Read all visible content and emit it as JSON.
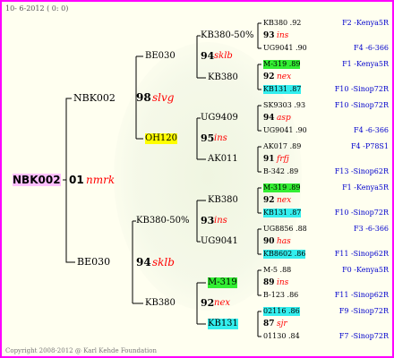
{
  "header": {
    "date_text": "10- 6-2012 ( 0: 0)"
  },
  "footer": {
    "copyright": "Copyright 2008-2012 @ Karl Kehde Foundation"
  },
  "colors": {
    "border": "#ff00ff",
    "red": "#ff0000",
    "blue": "#0000cc",
    "green_hl": "#33ee33",
    "cyan_hl": "#33eeee",
    "yellow_hl": "#ffff00",
    "pink_hl": "#ffc0ff"
  },
  "root": {
    "name": "NBK002",
    "num": "01",
    "tag": "nmrk"
  },
  "gen2": {
    "sire": {
      "name": "NBK002",
      "num": "98",
      "tag": "slvg"
    },
    "dam": {
      "name": "BE030",
      "num": "94",
      "tag": "sklb"
    }
  },
  "gen3": {
    "ss": {
      "name": "BE030",
      "num": "94",
      "tag": "sklb"
    },
    "sd": {
      "name": "OH120",
      "num": "95",
      "tag": "ins"
    },
    "ds": {
      "name": "KB380-50%",
      "num": "93",
      "tag": "ins"
    },
    "dd": {
      "name": "KB380",
      "num": "92",
      "tag": "nex"
    }
  },
  "gen4": {
    "sss": {
      "name": "KB380-50%",
      "num": "93",
      "tag": "ins"
    },
    "ssd": {
      "name": "KB380"
    },
    "sds": {
      "name": "UG9409"
    },
    "sdd": {
      "name": "AK011"
    },
    "dss": {
      "name": "KB380"
    },
    "dsd": {
      "name": "UG9041"
    },
    "dds": {
      "name": "M-319"
    },
    "ddd": {
      "name": "KB131"
    }
  },
  "gen5": [
    {
      "name": "KB380 .92",
      "anc": "F2 -Kenya5R"
    },
    {
      "num": "93",
      "tag": "ins"
    },
    {
      "name": "UG9041 .90",
      "anc": "F4 -6-366"
    },
    {
      "name": "M-319 .89",
      "anc": "F1 -Kenya5R"
    },
    {
      "num": "92",
      "tag": "nex"
    },
    {
      "name": "KB131 .87",
      "anc": "F10 -Sinop72R"
    },
    {
      "name": "SK9303 .93",
      "anc": "F10 -Sinop72R"
    },
    {
      "num": "94",
      "tag": "asp"
    },
    {
      "name": "UG9041 .90",
      "anc": "F4 -6-366"
    },
    {
      "name": "AK017 .89",
      "anc": "F4 -P78S1"
    },
    {
      "num": "91",
      "tag": "frfj"
    },
    {
      "name": "B-342 .89",
      "anc": "F13 -Sinop62R"
    },
    {
      "name": "M-319 .89",
      "anc": "F1 -Kenya5R"
    },
    {
      "num": "92",
      "tag": "nex"
    },
    {
      "name": "KB131 .87",
      "anc": "F10 -Sinop72R"
    },
    {
      "name": "UG8856 .88",
      "anc": "F3 -6-366"
    },
    {
      "num": "90",
      "tag": "has"
    },
    {
      "name": "KB8602 .86",
      "anc": "F11 -Sinop62R"
    },
    {
      "name": "M-5 .88",
      "anc": "F0 -Kenya5R"
    },
    {
      "num": "89",
      "tag": "ins"
    },
    {
      "name": "B-123 .86",
      "anc": "F11 -Sinop62R"
    },
    {
      "name": "02116 .86",
      "anc": "F9 -Sinop72R"
    },
    {
      "num": "87",
      "tag": "sjr"
    },
    {
      "name": "01130 .84",
      "anc": "F7 -Sinop72R"
    }
  ]
}
